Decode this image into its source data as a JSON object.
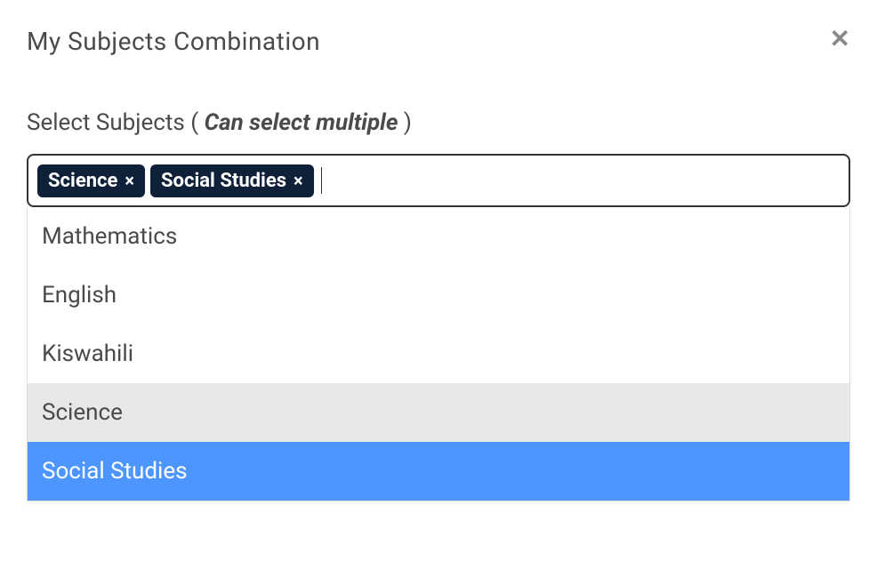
{
  "modal": {
    "title": "My Subjects Combination"
  },
  "field": {
    "label_prefix": "Select Subjects ( ",
    "hint": "Can select multiple",
    "label_suffix": " )"
  },
  "selected": [
    {
      "label": "Science"
    },
    {
      "label": "Social Studies"
    }
  ],
  "chip_remove_glyph": "×",
  "options": [
    {
      "label": "Mathematics",
      "state": "normal"
    },
    {
      "label": "English",
      "state": "normal"
    },
    {
      "label": "Kiswahili",
      "state": "normal"
    },
    {
      "label": "Science",
      "state": "selected"
    },
    {
      "label": "Social Studies",
      "state": "highlighted"
    }
  ]
}
